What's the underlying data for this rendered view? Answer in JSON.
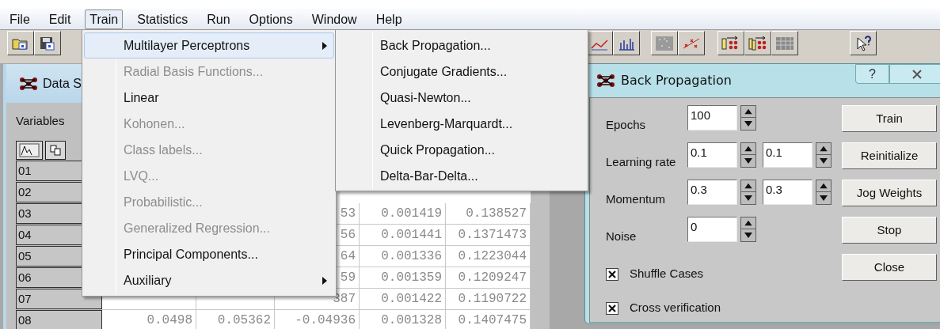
{
  "menu_bar": [
    {
      "label": "File",
      "selected": false
    },
    {
      "label": "Edit",
      "selected": false
    },
    {
      "label": "Train",
      "selected": true
    },
    {
      "label": "Statistics",
      "selected": false
    },
    {
      "label": "Run",
      "selected": false
    },
    {
      "label": "Options",
      "selected": false
    },
    {
      "label": "Window",
      "selected": false
    },
    {
      "label": "Help",
      "selected": false
    }
  ],
  "data_sheet": {
    "title": "Data S",
    "variables_label": "Variables",
    "rows": [
      {
        "label": "01"
      },
      {
        "label": "02"
      },
      {
        "label": "03",
        "cells": {
          "column_3": "53",
          "column_4": "0.001419",
          "column_5": "0.138527"
        }
      },
      {
        "label": "04",
        "cells": {
          "column_3": "56",
          "column_4": "0.001441",
          "column_5": "0.1371473"
        }
      },
      {
        "label": "05",
        "cells": {
          "column_3": "64",
          "column_4": "0.001336",
          "column_5": "0.1223044"
        }
      },
      {
        "label": "06",
        "cells": {
          "column_3": "59",
          "column_4": "0.001359",
          "column_5": "0.1209247"
        }
      },
      {
        "label": "07",
        "cells": {
          "column_3": "387",
          "column_4": "0.001422",
          "column_5": "0.1190722"
        }
      },
      {
        "label": "08",
        "cells": {
          "column_1": "0.0498",
          "column_2": "0.05362",
          "column_3": "-0.04936",
          "column_4": "0.001328",
          "column_5": "0.1407475"
        }
      }
    ]
  },
  "train_menu": {
    "items": [
      {
        "label": "Multilayer Perceptrons",
        "disabled": false,
        "submenu": true,
        "selected": true
      },
      {
        "label": "Radial Basis Functions...",
        "disabled": true,
        "submenu": false,
        "selected": false
      },
      {
        "label": "Linear",
        "disabled": false,
        "submenu": false,
        "selected": false
      },
      {
        "label": "Kohonen...",
        "disabled": true,
        "submenu": false,
        "selected": false
      },
      {
        "label": "Class labels...",
        "disabled": true,
        "submenu": false,
        "selected": false
      },
      {
        "label": "LVQ...",
        "disabled": true,
        "submenu": false,
        "selected": false
      },
      {
        "label": "Probabilistic...",
        "disabled": true,
        "submenu": false,
        "selected": false
      },
      {
        "label": "Generalized Regression...",
        "disabled": true,
        "submenu": false,
        "selected": false
      },
      {
        "label": "Principal Components...",
        "disabled": false,
        "submenu": false,
        "selected": false
      },
      {
        "label": "Auxiliary",
        "disabled": false,
        "submenu": true,
        "selected": false
      }
    ]
  },
  "mlp_submenu": {
    "items": [
      {
        "label": "Back Propagation...",
        "selected": false
      },
      {
        "label": "Conjugate Gradients...",
        "selected": false
      },
      {
        "label": "Quasi-Newton...",
        "selected": false
      },
      {
        "label": "Levenberg-Marquardt...",
        "selected": false
      },
      {
        "label": "Quick Propagation...",
        "selected": false
      },
      {
        "label": "Delta-Bar-Delta...",
        "selected": false
      }
    ]
  },
  "dialog": {
    "title": "Back Propagation",
    "help_button": "?",
    "fields": [
      {
        "label": "Epochs",
        "values": [
          "100"
        ]
      },
      {
        "label": "Learning rate",
        "values": [
          "0.1",
          "0.1"
        ]
      },
      {
        "label": "Momentum",
        "values": [
          "0.3",
          "0.3"
        ]
      },
      {
        "label": "Noise",
        "values": [
          "0"
        ]
      }
    ],
    "checkboxes": [
      {
        "label": "Shuffle Cases",
        "checked": true
      },
      {
        "label": "Cross verification",
        "checked": true
      }
    ],
    "buttons": [
      "Train",
      "Reinitialize",
      "Jog Weights",
      "Stop",
      "Close"
    ]
  }
}
